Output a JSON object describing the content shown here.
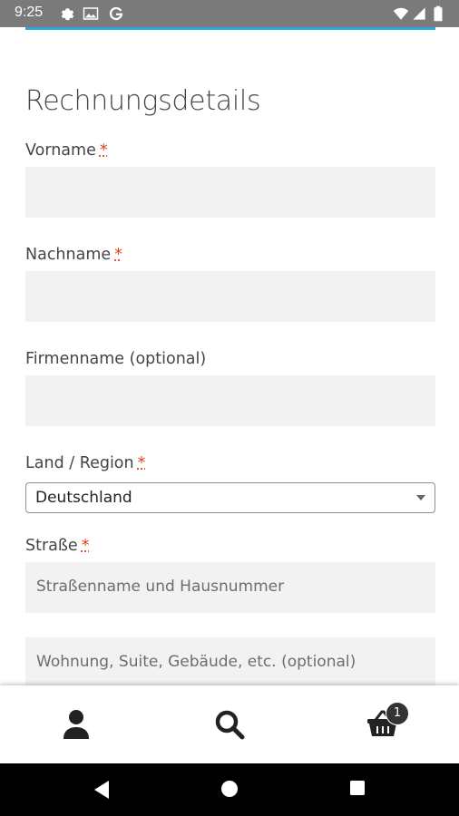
{
  "status_bar": {
    "time": "9:25",
    "icons_left": [
      "gear-icon",
      "image-icon",
      "google-icon"
    ],
    "icons_right": [
      "wifi-icon",
      "signal-icon",
      "battery-icon"
    ]
  },
  "page": {
    "title": "Rechnungsdetails"
  },
  "form": {
    "first_name": {
      "label": "Vorname",
      "required_mark": "*",
      "value": ""
    },
    "last_name": {
      "label": "Nachname",
      "required_mark": "*",
      "value": ""
    },
    "company": {
      "label": "Firmenname (optional)",
      "value": ""
    },
    "country": {
      "label": "Land / Region",
      "required_mark": "*",
      "selected": "Deutschland"
    },
    "street": {
      "label": "Straße",
      "required_mark": "*",
      "placeholder": "Straßenname und Hausnummer",
      "placeholder2": "Wohnung, Suite, Gebäude, etc. (optional)"
    }
  },
  "bottom_nav": {
    "items": [
      {
        "icon": "user-icon"
      },
      {
        "icon": "search-icon"
      },
      {
        "icon": "basket-icon",
        "badge": "1"
      }
    ]
  },
  "system_nav": {
    "items": [
      "back-icon",
      "home-icon",
      "recents-icon"
    ]
  },
  "colors": {
    "status_bar": "#7a7a7a",
    "accent_rule": "#2fa4d6",
    "required": "#e2401c",
    "input_bg": "#f2f2f2",
    "text": "#43454b"
  }
}
